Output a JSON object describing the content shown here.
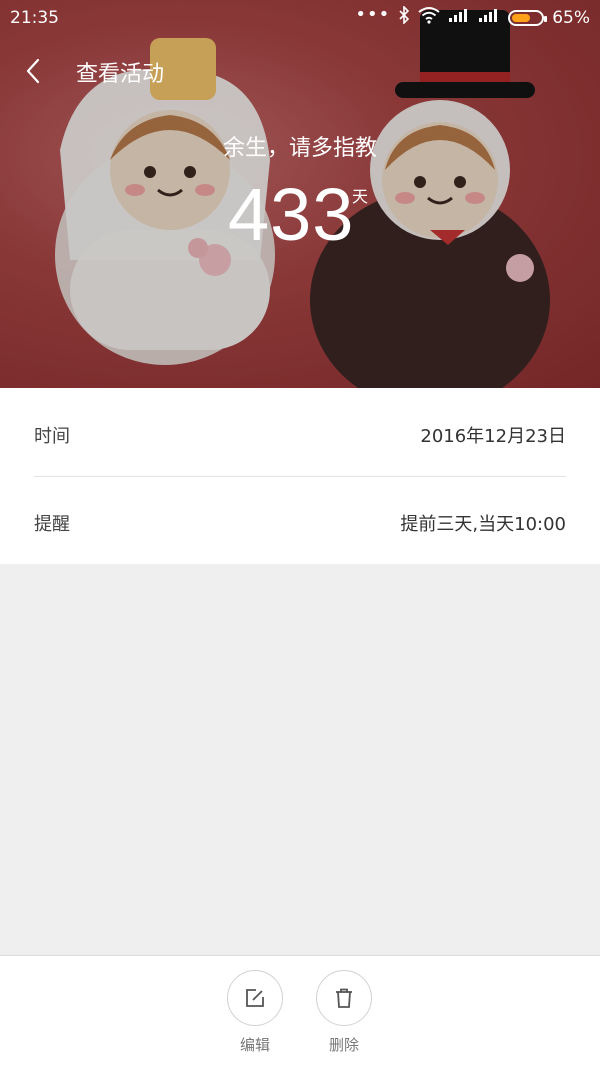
{
  "status_bar": {
    "time": "21:35",
    "battery_percent_text": "65%",
    "battery_level": 0.65,
    "battery_color": "#ffa21a"
  },
  "app_bar": {
    "title": "查看活动",
    "back_icon": "chevron-left-icon"
  },
  "event": {
    "title": "余生，请多指教",
    "days": "433",
    "unit": "天"
  },
  "details": [
    {
      "label": "时间",
      "value": "2016年12月23日"
    },
    {
      "label": "提醒",
      "value": "提前三天,当天10:00"
    }
  ],
  "actions": [
    {
      "label": "编辑",
      "icon": "edit-icon"
    },
    {
      "label": "删除",
      "icon": "trash-icon"
    }
  ]
}
